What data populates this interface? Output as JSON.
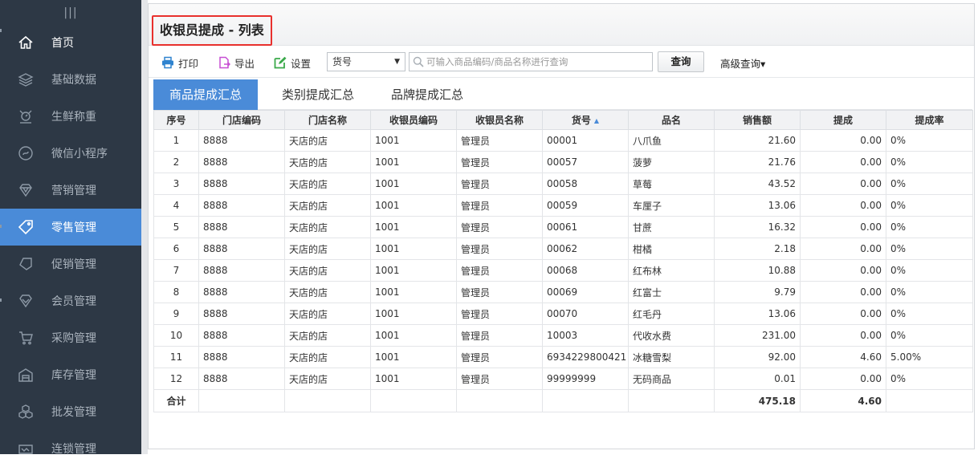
{
  "sidebar": {
    "grip": "|||",
    "items": [
      {
        "label": "首页",
        "icon": "home-icon"
      },
      {
        "label": "基础数据",
        "icon": "layers-icon"
      },
      {
        "label": "生鲜称重",
        "icon": "scale-icon"
      },
      {
        "label": "微信小程序",
        "icon": "mini-program-icon"
      },
      {
        "label": "营销管理",
        "icon": "diamond-icon"
      },
      {
        "label": "零售管理",
        "icon": "tag-icon"
      },
      {
        "label": "促销管理",
        "icon": "promo-tag-icon"
      },
      {
        "label": "会员管理",
        "icon": "member-diamond-icon"
      },
      {
        "label": "采购管理",
        "icon": "cart-icon"
      },
      {
        "label": "库存管理",
        "icon": "warehouse-icon"
      },
      {
        "label": "批发管理",
        "icon": "boxes-icon"
      },
      {
        "label": "连锁管理",
        "icon": "chain-icon"
      }
    ],
    "active_index": 5
  },
  "page": {
    "title": "收银员提成 - 列表"
  },
  "toolbar": {
    "print_label": "打印",
    "export_label": "导出",
    "settings_label": "设置",
    "field_select_value": "货号",
    "search_placeholder": "可输入商品编码/商品名称进行查询",
    "query_label": "查询",
    "advanced_label": "高级查询▾"
  },
  "tabs": [
    {
      "label": "商品提成汇总",
      "active": true
    },
    {
      "label": "类别提成汇总",
      "active": false
    },
    {
      "label": "品牌提成汇总",
      "active": false
    }
  ],
  "table": {
    "columns": [
      "序号",
      "门店编码",
      "门店名称",
      "收银员编码",
      "收银员名称",
      "货号",
      "品名",
      "销售额",
      "提成",
      "提成率"
    ],
    "sort_indicator": "▲",
    "rows": [
      [
        "1",
        "8888",
        "天店的店",
        "1001",
        "管理员",
        "00001",
        "八爪鱼",
        "21.60",
        "0.00",
        "0%"
      ],
      [
        "2",
        "8888",
        "天店的店",
        "1001",
        "管理员",
        "00057",
        "菠萝",
        "21.76",
        "0.00",
        "0%"
      ],
      [
        "3",
        "8888",
        "天店的店",
        "1001",
        "管理员",
        "00058",
        "草莓",
        "43.52",
        "0.00",
        "0%"
      ],
      [
        "4",
        "8888",
        "天店的店",
        "1001",
        "管理员",
        "00059",
        "车厘子",
        "13.06",
        "0.00",
        "0%"
      ],
      [
        "5",
        "8888",
        "天店的店",
        "1001",
        "管理员",
        "00061",
        "甘蔗",
        "16.32",
        "0.00",
        "0%"
      ],
      [
        "6",
        "8888",
        "天店的店",
        "1001",
        "管理员",
        "00062",
        "柑橘",
        "2.18",
        "0.00",
        "0%"
      ],
      [
        "7",
        "8888",
        "天店的店",
        "1001",
        "管理员",
        "00068",
        "红布林",
        "10.88",
        "0.00",
        "0%"
      ],
      [
        "8",
        "8888",
        "天店的店",
        "1001",
        "管理员",
        "00069",
        "红富士",
        "9.79",
        "0.00",
        "0%"
      ],
      [
        "9",
        "8888",
        "天店的店",
        "1001",
        "管理员",
        "00070",
        "红毛丹",
        "13.06",
        "0.00",
        "0%"
      ],
      [
        "10",
        "8888",
        "天店的店",
        "1001",
        "管理员",
        "10003",
        "代收水费",
        "231.00",
        "0.00",
        "0%"
      ],
      [
        "11",
        "8888",
        "天店的店",
        "1001",
        "管理员",
        "6934229800421",
        "冰糖雪梨",
        "92.00",
        "4.60",
        "5.00%"
      ],
      [
        "12",
        "8888",
        "天店的店",
        "1001",
        "管理员",
        "99999999",
        "无码商品",
        "0.01",
        "0.00",
        "0%"
      ]
    ],
    "total": {
      "label": "合计",
      "sales": "475.18",
      "commission": "4.60"
    }
  },
  "colors": {
    "accent": "#4a8bd8",
    "sidebar_bg": "#2d3845",
    "highlight_border": "#e8302d"
  }
}
